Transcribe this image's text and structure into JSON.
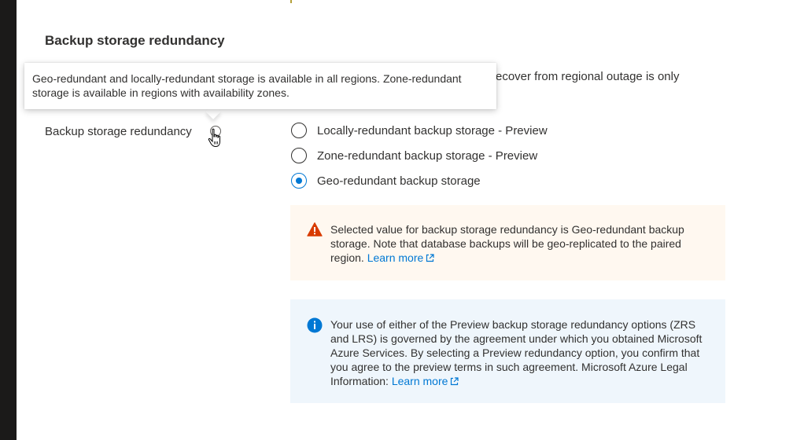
{
  "section": {
    "title": "Backup storage redundancy"
  },
  "description": {
    "visible_text": "recover from regional outage is only"
  },
  "field": {
    "label": "Backup storage redundancy"
  },
  "tooltip": {
    "text": "Geo-redundant and locally-redundant storage is available in all regions. Zone-redundant storage is available in regions with availability zones."
  },
  "radio_options": [
    {
      "label": "Locally-redundant backup storage - Preview",
      "checked": false
    },
    {
      "label": "Zone-redundant backup storage - Preview",
      "checked": false
    },
    {
      "label": "Geo-redundant backup storage",
      "checked": true
    }
  ],
  "warning_box": {
    "text": "Selected value for backup storage redundancy is Geo-redundant backup storage. Note that database backups will be geo-replicated to the paired region.",
    "link_label": "Learn more",
    "icon": "warning-icon",
    "color": "#d83b01"
  },
  "info_box": {
    "text": "Your use of either of the Preview backup storage redundancy options (ZRS and LRS) is governed by the agreement under which you obtained Microsoft Azure Services. By selecting a Preview redundancy option, you confirm that you agree to the preview terms in such agreement. Microsoft Azure Legal Information:",
    "link_label": "Learn more",
    "icon": "info-icon",
    "color": "#0078d4"
  },
  "colors": {
    "accent": "#0078d4",
    "warning_bg": "#fff8f0",
    "info_bg": "#eff6fc",
    "text": "#323130"
  }
}
